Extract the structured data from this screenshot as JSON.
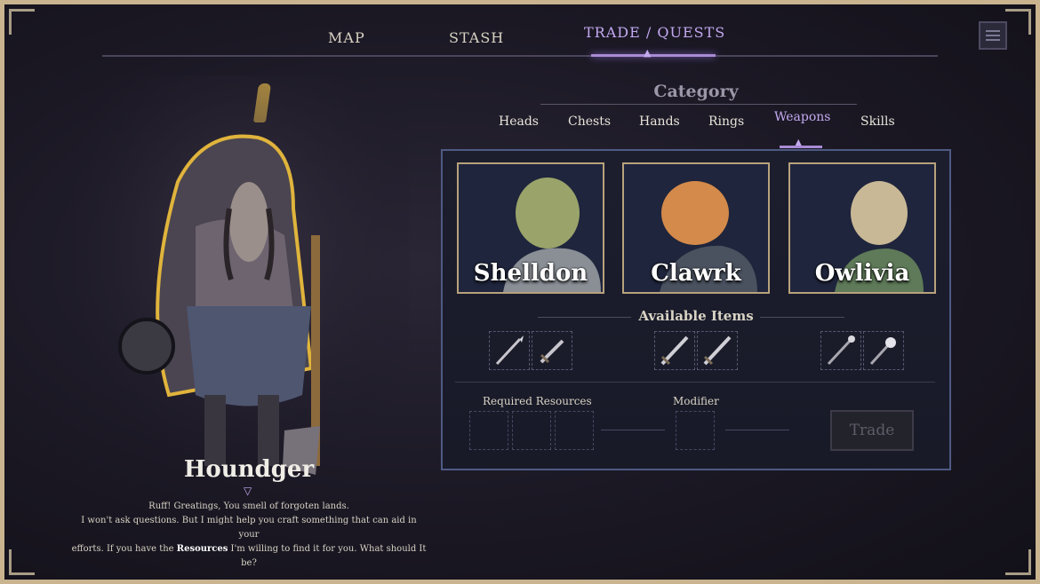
{
  "nav": {
    "tabs": [
      {
        "label": "MAP"
      },
      {
        "label": "STASH"
      },
      {
        "label": "TRADE / QUESTS",
        "active": true
      }
    ]
  },
  "menu_icon": "hamburger-menu-icon",
  "character": {
    "name": "Houndger",
    "dialog_line1": "Ruff! Greatings, You smell of forgoten lands.",
    "dialog_line2": "I won't ask questions. But I might help you craft something that can aid in your",
    "dialog_line3_pre": "efforts. If you have the ",
    "dialog_line3_bold": "Resources",
    "dialog_line3_post": " I'm willing to find it for you.  What should It be?"
  },
  "category": {
    "title": "Category",
    "tabs": [
      {
        "label": "Heads"
      },
      {
        "label": "Chests"
      },
      {
        "label": "Hands"
      },
      {
        "label": "Rings"
      },
      {
        "label": "Weapons",
        "active": true
      },
      {
        "label": "Skills"
      }
    ]
  },
  "merchants": [
    {
      "name": "Shelldon"
    },
    {
      "name": "Clawrk"
    },
    {
      "name": "Owlivia"
    }
  ],
  "available_items": {
    "title": "Available Items",
    "items": [
      "spear-icon",
      "dagger-icon",
      "sword-icon",
      "sword-icon",
      "halberd-icon",
      "morningstar-icon"
    ]
  },
  "required_resources": {
    "label": "Required Resources"
  },
  "modifier": {
    "label": "Modifier"
  },
  "trade_button": {
    "label": "Trade",
    "enabled": false
  },
  "colors": {
    "accent": "#a98bd6",
    "frame": "#c9b48f",
    "candle": "#e6b948"
  }
}
